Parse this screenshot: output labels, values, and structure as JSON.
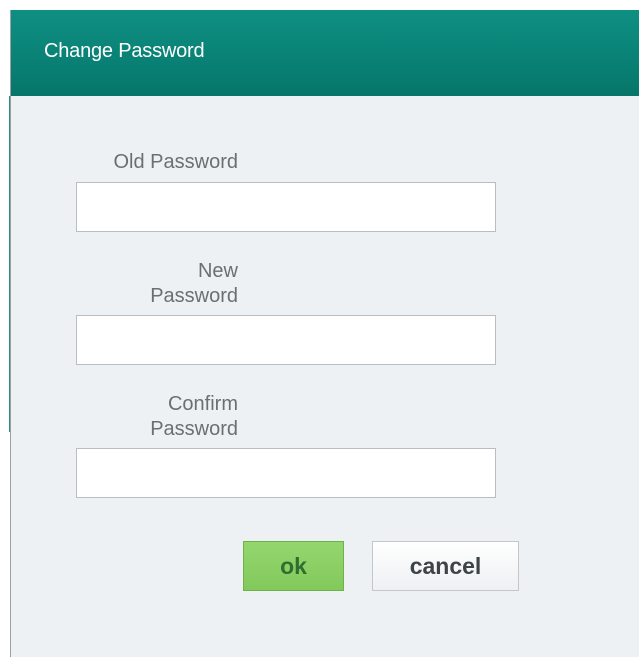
{
  "dialog": {
    "title": "Change Password"
  },
  "form": {
    "old_password_label": "Old Password",
    "new_password_label_line1": "New",
    "new_password_label_line2": "Password",
    "confirm_password_label_line1": "Confirm",
    "confirm_password_label_line2": "Password",
    "old_password_value": "",
    "new_password_value": "",
    "confirm_password_value": ""
  },
  "buttons": {
    "ok_label": "ok",
    "cancel_label": "cancel"
  },
  "colors": {
    "titlebar": "#0a8276",
    "dialog_background": "#eef1f4",
    "ok_button": "#88cd62",
    "cancel_button": "#f4f5f7"
  }
}
